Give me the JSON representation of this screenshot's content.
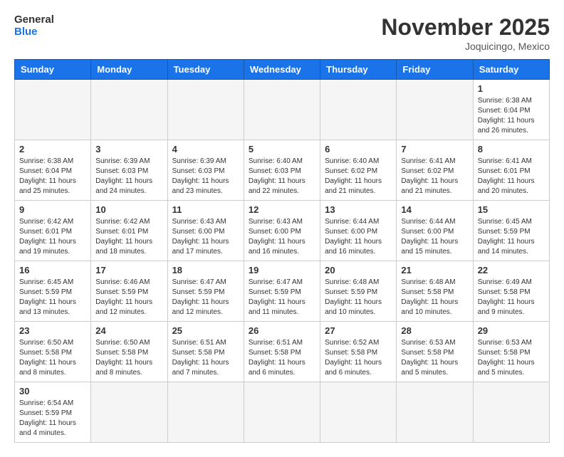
{
  "header": {
    "logo_general": "General",
    "logo_blue": "Blue",
    "month_title": "November 2025",
    "location": "Joquicingo, Mexico"
  },
  "days_of_week": [
    "Sunday",
    "Monday",
    "Tuesday",
    "Wednesday",
    "Thursday",
    "Friday",
    "Saturday"
  ],
  "weeks": [
    [
      {
        "day": "",
        "info": ""
      },
      {
        "day": "",
        "info": ""
      },
      {
        "day": "",
        "info": ""
      },
      {
        "day": "",
        "info": ""
      },
      {
        "day": "",
        "info": ""
      },
      {
        "day": "",
        "info": ""
      },
      {
        "day": "1",
        "info": "Sunrise: 6:38 AM\nSunset: 6:04 PM\nDaylight: 11 hours and 26 minutes."
      }
    ],
    [
      {
        "day": "2",
        "info": "Sunrise: 6:38 AM\nSunset: 6:04 PM\nDaylight: 11 hours and 25 minutes."
      },
      {
        "day": "3",
        "info": "Sunrise: 6:39 AM\nSunset: 6:03 PM\nDaylight: 11 hours and 24 minutes."
      },
      {
        "day": "4",
        "info": "Sunrise: 6:39 AM\nSunset: 6:03 PM\nDaylight: 11 hours and 23 minutes."
      },
      {
        "day": "5",
        "info": "Sunrise: 6:40 AM\nSunset: 6:03 PM\nDaylight: 11 hours and 22 minutes."
      },
      {
        "day": "6",
        "info": "Sunrise: 6:40 AM\nSunset: 6:02 PM\nDaylight: 11 hours and 21 minutes."
      },
      {
        "day": "7",
        "info": "Sunrise: 6:41 AM\nSunset: 6:02 PM\nDaylight: 11 hours and 21 minutes."
      },
      {
        "day": "8",
        "info": "Sunrise: 6:41 AM\nSunset: 6:01 PM\nDaylight: 11 hours and 20 minutes."
      }
    ],
    [
      {
        "day": "9",
        "info": "Sunrise: 6:42 AM\nSunset: 6:01 PM\nDaylight: 11 hours and 19 minutes."
      },
      {
        "day": "10",
        "info": "Sunrise: 6:42 AM\nSunset: 6:01 PM\nDaylight: 11 hours and 18 minutes."
      },
      {
        "day": "11",
        "info": "Sunrise: 6:43 AM\nSunset: 6:00 PM\nDaylight: 11 hours and 17 minutes."
      },
      {
        "day": "12",
        "info": "Sunrise: 6:43 AM\nSunset: 6:00 PM\nDaylight: 11 hours and 16 minutes."
      },
      {
        "day": "13",
        "info": "Sunrise: 6:44 AM\nSunset: 6:00 PM\nDaylight: 11 hours and 16 minutes."
      },
      {
        "day": "14",
        "info": "Sunrise: 6:44 AM\nSunset: 6:00 PM\nDaylight: 11 hours and 15 minutes."
      },
      {
        "day": "15",
        "info": "Sunrise: 6:45 AM\nSunset: 5:59 PM\nDaylight: 11 hours and 14 minutes."
      }
    ],
    [
      {
        "day": "16",
        "info": "Sunrise: 6:45 AM\nSunset: 5:59 PM\nDaylight: 11 hours and 13 minutes."
      },
      {
        "day": "17",
        "info": "Sunrise: 6:46 AM\nSunset: 5:59 PM\nDaylight: 11 hours and 12 minutes."
      },
      {
        "day": "18",
        "info": "Sunrise: 6:47 AM\nSunset: 5:59 PM\nDaylight: 11 hours and 12 minutes."
      },
      {
        "day": "19",
        "info": "Sunrise: 6:47 AM\nSunset: 5:59 PM\nDaylight: 11 hours and 11 minutes."
      },
      {
        "day": "20",
        "info": "Sunrise: 6:48 AM\nSunset: 5:59 PM\nDaylight: 11 hours and 10 minutes."
      },
      {
        "day": "21",
        "info": "Sunrise: 6:48 AM\nSunset: 5:58 PM\nDaylight: 11 hours and 10 minutes."
      },
      {
        "day": "22",
        "info": "Sunrise: 6:49 AM\nSunset: 5:58 PM\nDaylight: 11 hours and 9 minutes."
      }
    ],
    [
      {
        "day": "23",
        "info": "Sunrise: 6:50 AM\nSunset: 5:58 PM\nDaylight: 11 hours and 8 minutes."
      },
      {
        "day": "24",
        "info": "Sunrise: 6:50 AM\nSunset: 5:58 PM\nDaylight: 11 hours and 8 minutes."
      },
      {
        "day": "25",
        "info": "Sunrise: 6:51 AM\nSunset: 5:58 PM\nDaylight: 11 hours and 7 minutes."
      },
      {
        "day": "26",
        "info": "Sunrise: 6:51 AM\nSunset: 5:58 PM\nDaylight: 11 hours and 6 minutes."
      },
      {
        "day": "27",
        "info": "Sunrise: 6:52 AM\nSunset: 5:58 PM\nDaylight: 11 hours and 6 minutes."
      },
      {
        "day": "28",
        "info": "Sunrise: 6:53 AM\nSunset: 5:58 PM\nDaylight: 11 hours and 5 minutes."
      },
      {
        "day": "29",
        "info": "Sunrise: 6:53 AM\nSunset: 5:58 PM\nDaylight: 11 hours and 5 minutes."
      }
    ],
    [
      {
        "day": "30",
        "info": "Sunrise: 6:54 AM\nSunset: 5:59 PM\nDaylight: 11 hours and 4 minutes."
      },
      {
        "day": "",
        "info": ""
      },
      {
        "day": "",
        "info": ""
      },
      {
        "day": "",
        "info": ""
      },
      {
        "day": "",
        "info": ""
      },
      {
        "day": "",
        "info": ""
      },
      {
        "day": "",
        "info": ""
      }
    ]
  ]
}
